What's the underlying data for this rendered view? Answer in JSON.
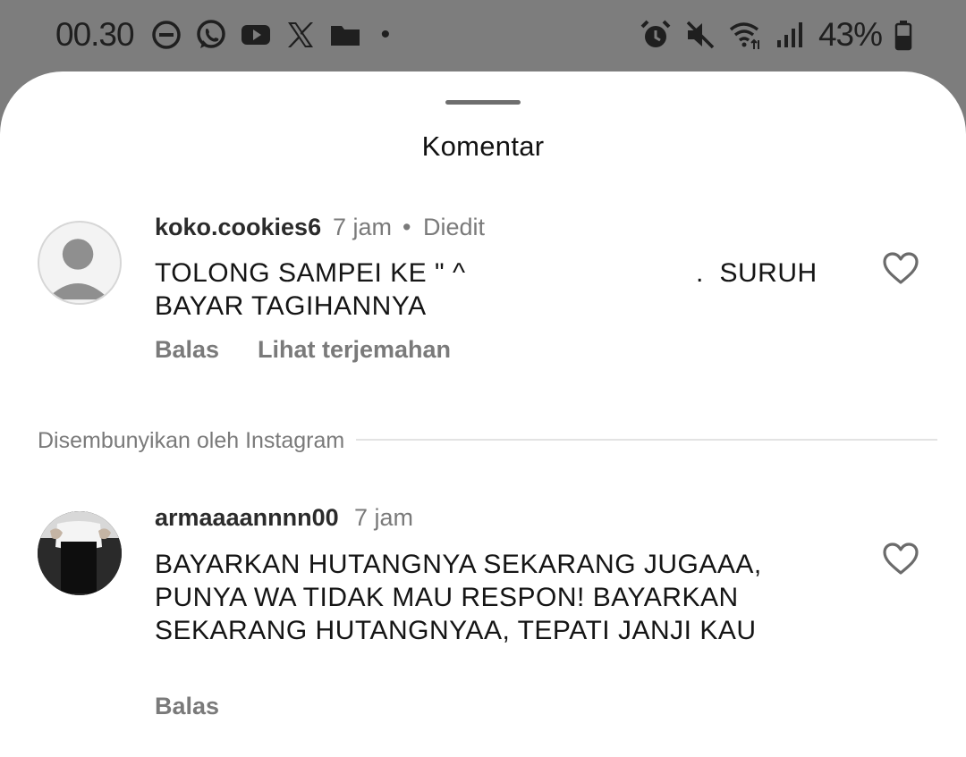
{
  "status_bar": {
    "time": "00.30",
    "left_icons": [
      "do-not-disturb-icon",
      "whatsapp-icon",
      "youtube-icon",
      "x-icon",
      "folder-icon"
    ],
    "dot": "•",
    "right_icons": [
      "alarm-icon",
      "mute-icon",
      "wifi-icon",
      "signal-icon"
    ],
    "battery_percent": "43%"
  },
  "sheet": {
    "title": "Komentar"
  },
  "comments": [
    {
      "username": "koko.cookies6",
      "time": "7 jam",
      "separator": "•",
      "edited": "Diedit",
      "text_line1": "TOLONG SAMPEI KE \" ^",
      "text_line1b": ".  SURUH",
      "text_line2": "BAYAR TAGIHANNYA",
      "reply": "Balas",
      "translate": "Lihat terjemahan"
    },
    {
      "username": "armaaaannnn00",
      "time": "7 jam",
      "text_line1": "BAYARKAN HUTANGNYA SEKARANG JUGAAA,",
      "text_line2": "PUNYA WA TIDAK MAU RESPON! BAYARKAN",
      "text_line3": "SEKARANG HUTANGNYAA, TEPATI JANJI KAU",
      "reply": "Balas"
    }
  ],
  "hidden_section": {
    "label": "Disembunyikan oleh Instagram"
  },
  "colors": {
    "background_dim": "#7d7d7d",
    "sheet": "#ffffff",
    "muted_text": "#7a7a7a",
    "primary_text": "#151515"
  }
}
